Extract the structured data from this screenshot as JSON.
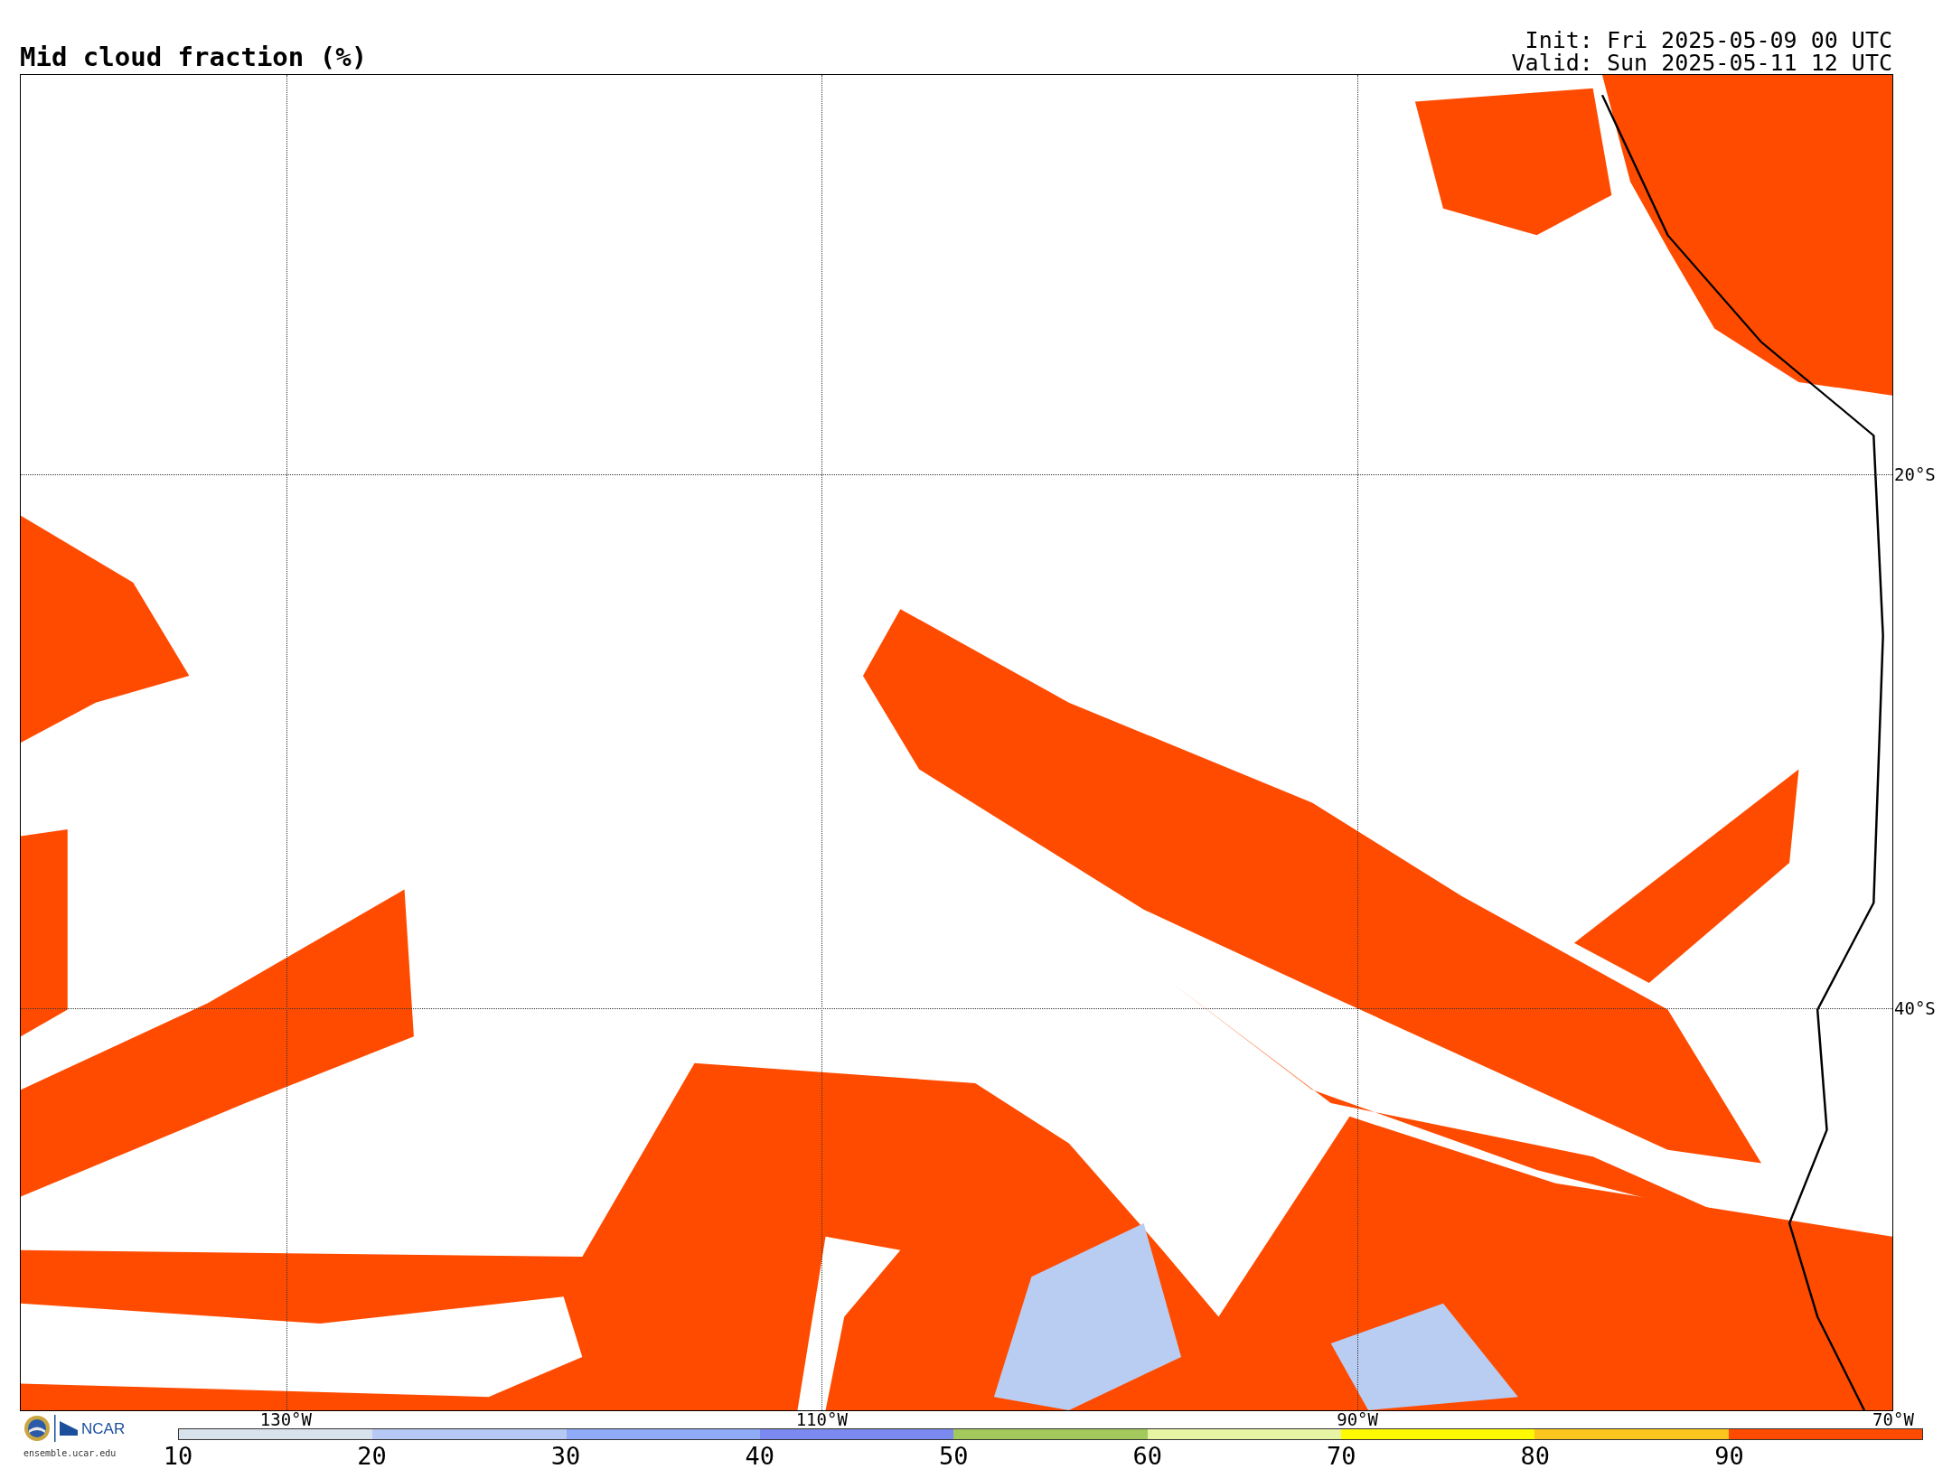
{
  "title": "Mid cloud fraction (%)",
  "run_info": [
    "Init: Fri 2025-05-09 00 UTC",
    "Valid: Sun 2025-05-11 12 UTC"
  ],
  "map": {
    "lat_labels": [
      "20°S",
      "40°S"
    ],
    "lon_labels": [
      "130°W",
      "110°W",
      "90°W",
      "70°W"
    ]
  },
  "logo": {
    "wordmark": "NCAR",
    "url": "ensemble.ucar.edu"
  },
  "colorbar": {
    "bins": [
      {
        "color": "#d8e2ec"
      },
      {
        "color": "#b6c9f5"
      },
      {
        "color": "#8fabf5"
      },
      {
        "color": "#7a8af1"
      },
      {
        "color": "#a3c95c"
      },
      {
        "color": "#e6f4a4"
      },
      {
        "color": "#fffa00"
      },
      {
        "color": "#fcc61e"
      },
      {
        "color": "#ff4a00"
      }
    ],
    "ticks": [
      "10",
      "20",
      "30",
      "40",
      "50",
      "60",
      "70",
      "80",
      "90"
    ]
  }
}
